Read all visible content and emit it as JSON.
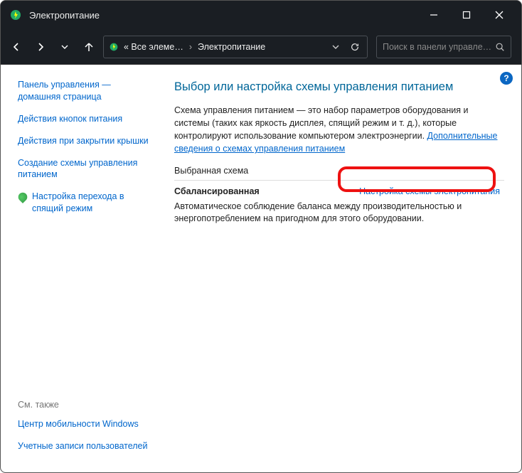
{
  "window": {
    "title": "Электропитание"
  },
  "nav": {
    "breadcrumb_prefix": "« Все элеме…",
    "breadcrumb_current": "Электропитание"
  },
  "search": {
    "placeholder": "Поиск в панели управлен…"
  },
  "sidebar": {
    "items": [
      "Панель управления — домашняя страница",
      "Действия кнопок питания",
      "Действия при закрытии крышки",
      "Создание схемы управления питанием",
      "Настройка перехода в спящий режим"
    ],
    "see_also_label": "См. также",
    "see_also": [
      "Центр мобильности Windows",
      "Учетные записи пользователей"
    ]
  },
  "main": {
    "heading": "Выбор или настройка схемы управления питанием",
    "description_pre": "Схема управления питанием — это набор параметров оборудования и системы (таких как яркость дисплея, спящий режим и т. д.), которые контролируют использование компьютером электроэнергии. ",
    "description_link": "Дополнительные сведения о схемах управления питанием",
    "section_label": "Выбранная схема",
    "plan_name": "Сбалансированная",
    "plan_link": "Настройка схемы электропитания",
    "plan_desc": "Автоматическое соблюдение баланса между производительностью и энергопотреблением на пригодном для этого оборудовании."
  },
  "help": "?"
}
